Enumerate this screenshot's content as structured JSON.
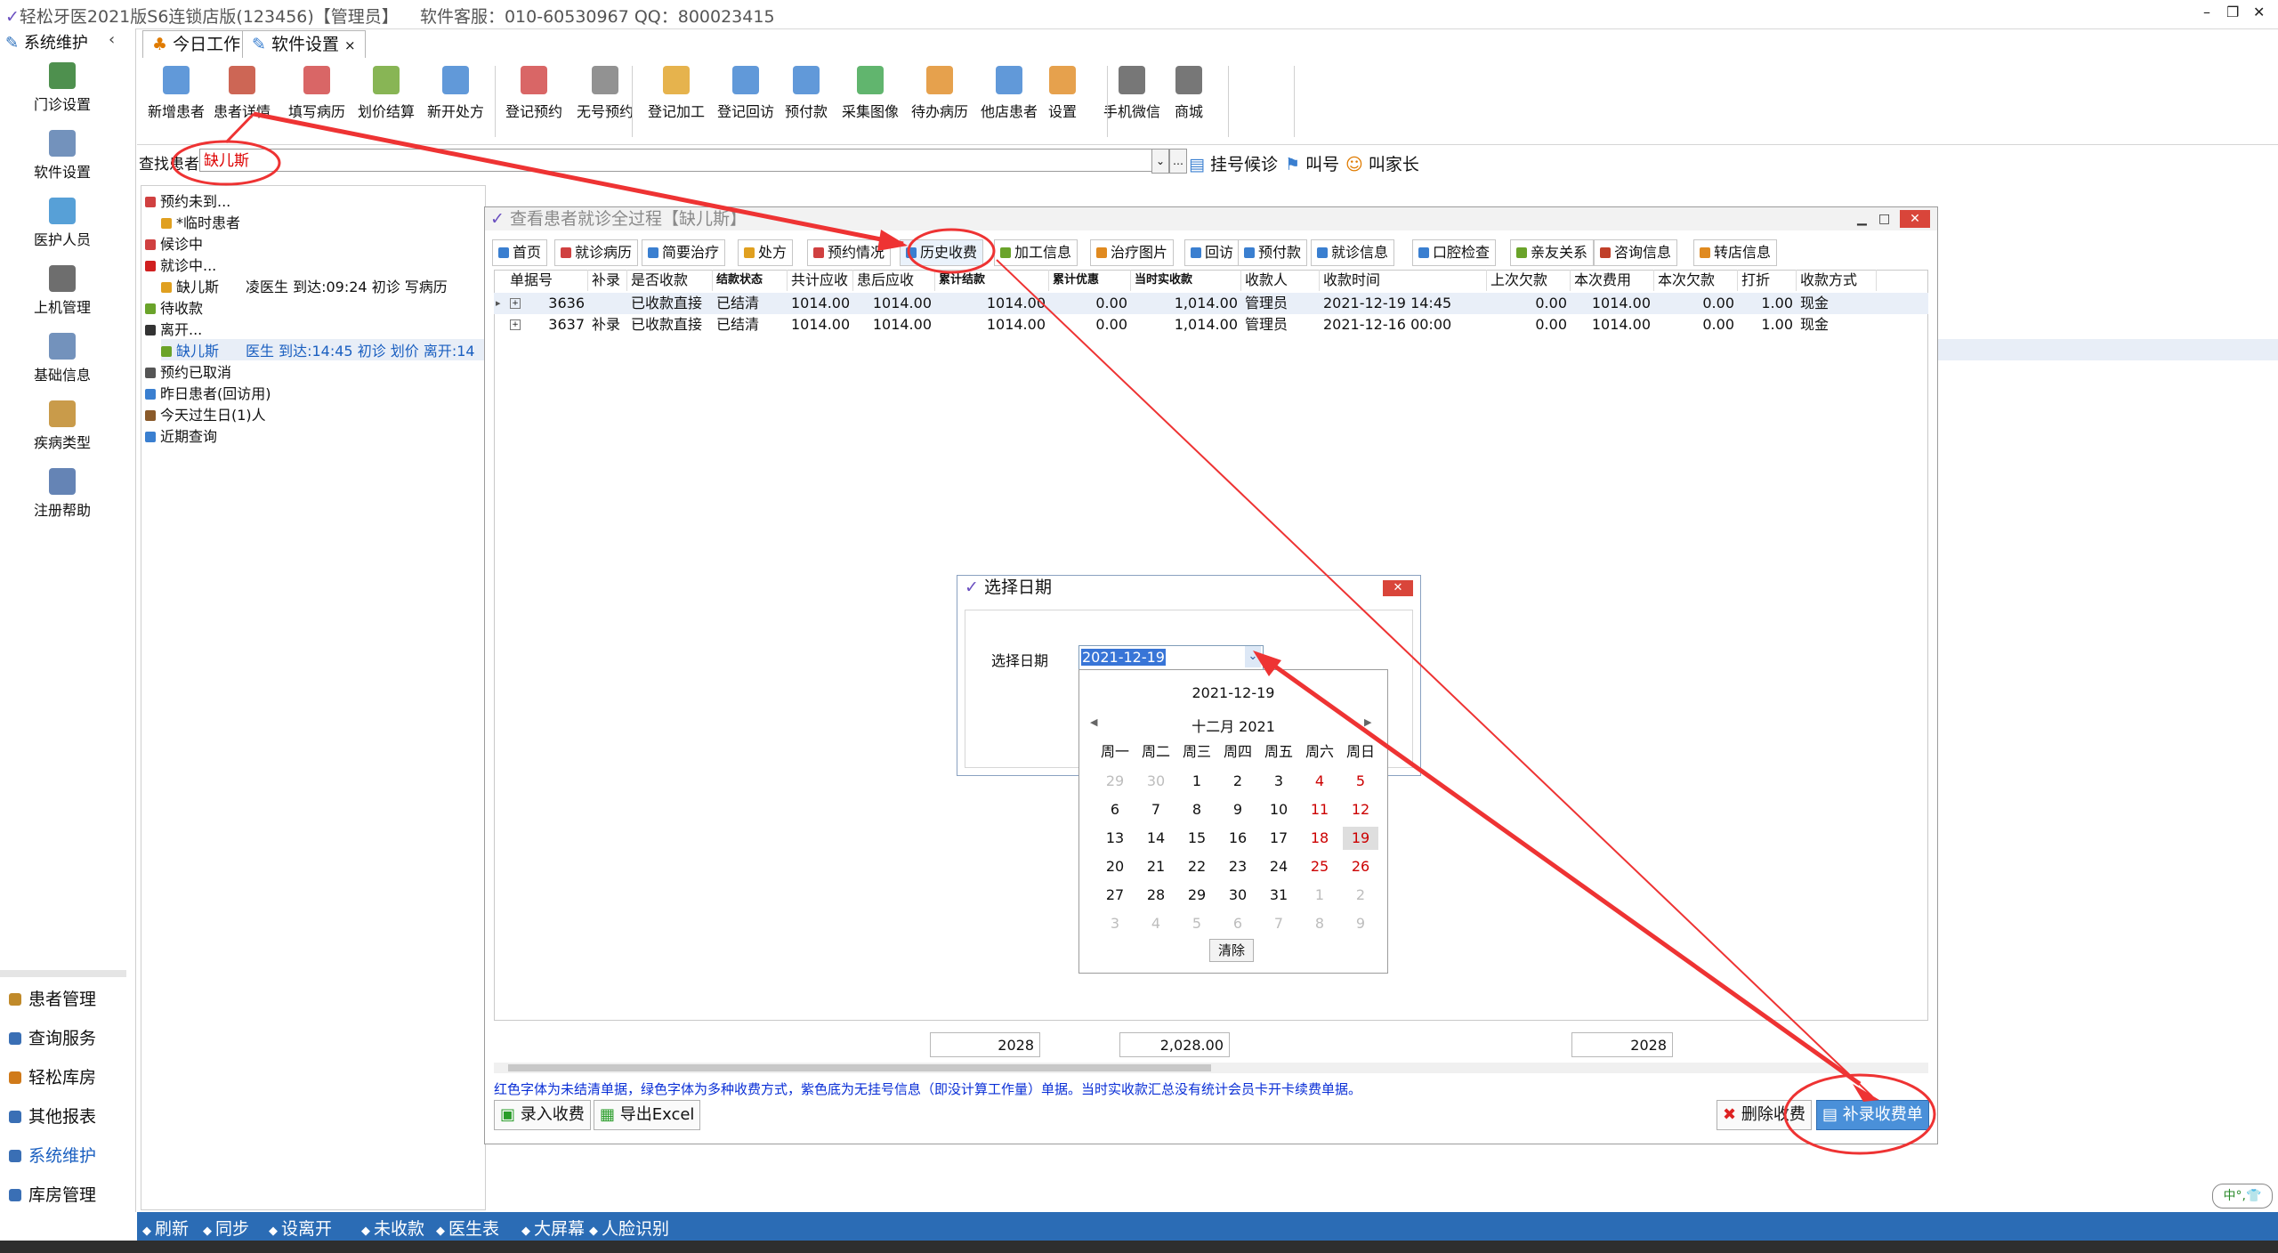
{
  "window": {
    "title": "轻松牙医2021版S6连锁店版(123456)【管理员】",
    "service": "软件客服：010-60530967 QQ：800023415"
  },
  "nav": {
    "header": "系统维护",
    "items": [
      {
        "label": "门诊设置",
        "icon": "house-icon"
      },
      {
        "label": "软件设置",
        "icon": "gears-icon"
      },
      {
        "label": "医护人员",
        "icon": "people-icon"
      },
      {
        "label": "上机管理",
        "icon": "lock-icon"
      },
      {
        "label": "基础信息",
        "icon": "gear-doc-icon"
      },
      {
        "label": "疾病类型",
        "icon": "tree-icon"
      },
      {
        "label": "注册帮助",
        "icon": "help-icon"
      }
    ],
    "dots": "……",
    "bottom": [
      {
        "label": "患者管理"
      },
      {
        "label": "查询服务"
      },
      {
        "label": "轻松库房"
      },
      {
        "label": "其他报表"
      },
      {
        "label": "系统维护",
        "active": true
      },
      {
        "label": "库房管理"
      }
    ]
  },
  "tabs": [
    {
      "label": "今日工作"
    },
    {
      "label": "软件设置",
      "close": "×"
    }
  ],
  "toolbar": [
    {
      "label": "新增患者"
    },
    {
      "label": "患者详情"
    },
    {
      "label": "填写病历"
    },
    {
      "label": "划价结算"
    },
    {
      "label": "新开处方"
    },
    {
      "label": "登记预约"
    },
    {
      "label": "无号预约"
    },
    {
      "label": "登记加工"
    },
    {
      "label": "登记回访"
    },
    {
      "label": "预付款"
    },
    {
      "label": "采集图像"
    },
    {
      "label": "待办病历"
    },
    {
      "label": "他店患者"
    },
    {
      "label": "设置"
    },
    {
      "label": "手机微信"
    },
    {
      "label": "商城"
    }
  ],
  "search": {
    "label": "查找患者",
    "value": "缺儿斯",
    "actions": [
      "挂号候诊",
      "叫号",
      "叫家长"
    ]
  },
  "tree": [
    {
      "label": "预约未到..."
    },
    {
      "label": "*临时患者"
    },
    {
      "label": "候诊中"
    },
    {
      "label": "就诊中..."
    },
    {
      "label": "缺儿斯",
      "detail": "凌医生 到达:09:24 初诊 写病历"
    },
    {
      "label": "待收款"
    },
    {
      "label": "离开..."
    },
    {
      "label": "缺儿斯",
      "detail": "医生   到达:14:45 初诊 划价 离开:14"
    },
    {
      "label": "预约已取消"
    },
    {
      "label": "昨日患者(回访用)"
    },
    {
      "label": "今天过生日(1)人"
    },
    {
      "label": "近期查询"
    }
  ],
  "patientWin": {
    "title": "查看患者就诊全过程【缺儿斯】",
    "tabs": [
      "首页",
      "就诊病历",
      "简要治疗",
      "处方",
      "预约情况",
      "历史收费",
      "加工信息",
      "治疗图片",
      "回访",
      "预付款",
      "就诊信息",
      "口腔检查",
      "亲友关系",
      "咨询信息",
      "转店信息"
    ],
    "columns": [
      "单据号",
      "补录",
      "是否收款",
      "结款状态",
      "共计应收",
      "患后应收",
      "累计结款",
      "累计优惠",
      "当时实收款",
      "收款人",
      "收款时间",
      "上次欠款",
      "本次费用",
      "本次欠款",
      "打折",
      "收款方式"
    ],
    "rows": [
      {
        "no": "3636",
        "bulu": "",
        "paid": "已收款直接",
        "status": "已结清",
        "total": "1014.00",
        "after": "1014.00",
        "cum": "1014.00",
        "disc": "0.00",
        "actual": "1,014.00",
        "payee": "管理员",
        "time": "2021-12-19 14:45",
        "last": "0.00",
        "fee": "1014.00",
        "owe": "0.00",
        "rate": "1.00",
        "method": "现金"
      },
      {
        "no": "3637",
        "bulu": "补录",
        "paid": "已收款直接",
        "status": "已结清",
        "total": "1014.00",
        "after": "1014.00",
        "cum": "1014.00",
        "disc": "0.00",
        "actual": "1,014.00",
        "payee": "管理员",
        "time": "2021-12-16 00:00",
        "last": "0.00",
        "fee": "1014.00",
        "owe": "0.00",
        "rate": "1.00",
        "method": "现金"
      }
    ],
    "totals": {
      "a": "2028",
      "b": "2,028.00",
      "c": "2028"
    },
    "note": "红色字体为未结清单据，绿色字体为多种收费方式，紫色底为无挂号信息（即没计算工作量）单据。当时实收款汇总没有统计会员卡开卡续费单据。",
    "buttons": {
      "add": "录入收费",
      "export": "导出Excel",
      "delete": "删除收费",
      "supplement": "补录收费单"
    }
  },
  "dateDialog": {
    "title": "选择日期",
    "label": "选择日期",
    "value": "2021-12-19",
    "calTop": "2021-12-19",
    "month": "十二月 2021",
    "weekdays": [
      "周一",
      "周二",
      "周三",
      "周四",
      "周五",
      "周六",
      "周日"
    ],
    "days": [
      [
        "29",
        "30",
        "1",
        "2",
        "3",
        "4",
        "5"
      ],
      [
        "6",
        "7",
        "8",
        "9",
        "10",
        "11",
        "12"
      ],
      [
        "13",
        "14",
        "15",
        "16",
        "17",
        "18",
        "19"
      ],
      [
        "20",
        "21",
        "22",
        "23",
        "24",
        "25",
        "26"
      ],
      [
        "27",
        "28",
        "29",
        "30",
        "31",
        "1",
        "2"
      ],
      [
        "3",
        "4",
        "5",
        "6",
        "7",
        "8",
        "9"
      ]
    ],
    "clear": "清除"
  },
  "statusbar": [
    "刷新",
    "同步",
    "设离开",
    "未收款",
    "医生表",
    "大屏幕",
    "人脸识别"
  ],
  "colors": {
    "statusBlue": "#2b6cb5",
    "annotationRed": "#ee3333",
    "selectedBlue": "#4a90d9"
  }
}
